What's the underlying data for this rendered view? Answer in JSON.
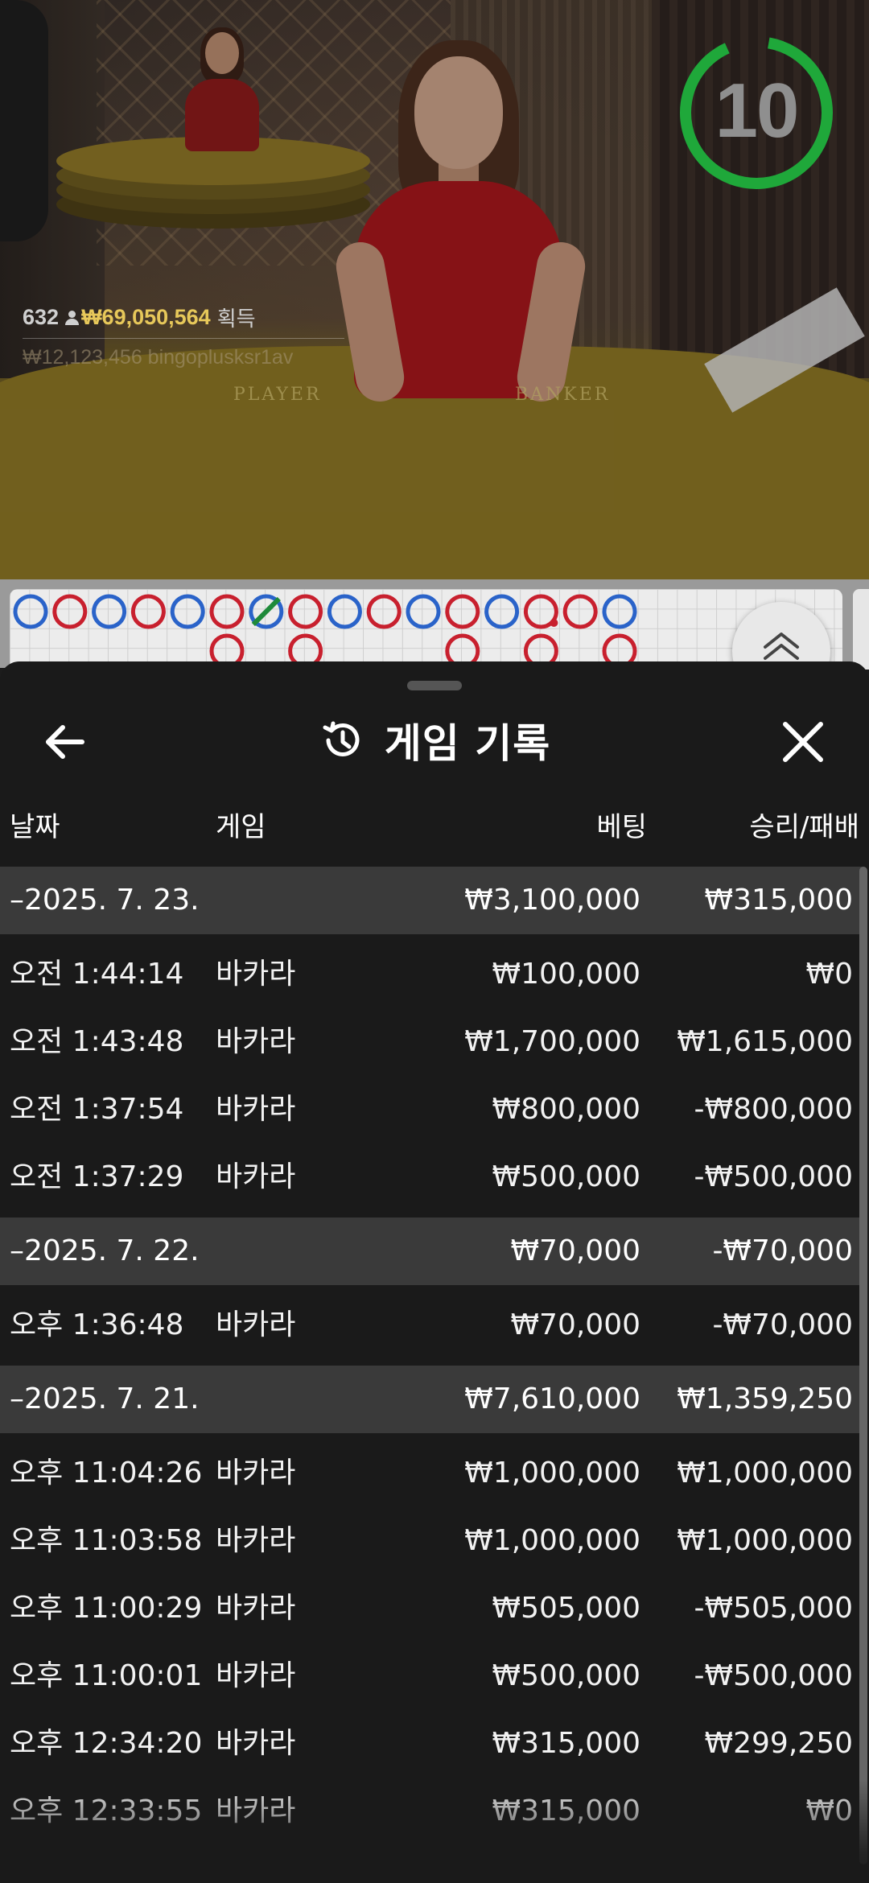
{
  "video": {
    "timer": "10",
    "player_count": "632",
    "jackpot_amount": "₩69,050,564",
    "jackpot_suffix": "획득",
    "recent_winner": "₩12,123,456  bingoplusksr1av",
    "table_labels": [
      "PLAYER",
      "BANKER"
    ],
    "timer_color": "#1fa83a"
  },
  "road": {
    "colors": {
      "banker": "#c8202e",
      "player": "#2a63c9",
      "tie": "#1f8a3a"
    },
    "top_row": [
      "P",
      "B",
      "P",
      "B",
      "P",
      "B",
      "P-tie",
      "B",
      "P",
      "B",
      "P",
      "B",
      "P",
      "B-pair",
      "B",
      "P"
    ],
    "bottom_row": [
      null,
      null,
      null,
      null,
      null,
      "B",
      null,
      "B",
      null,
      null,
      null,
      "B",
      null,
      "B",
      null,
      "B"
    ]
  },
  "sheet": {
    "title": "게임 기록",
    "icons": {
      "back": "arrow-left-icon",
      "history": "history-icon",
      "close": "close-icon"
    },
    "columns": {
      "date": "날짜",
      "game": "게임",
      "bet": "베팅",
      "winloss": "승리/패배"
    },
    "groups": [
      {
        "date": "–2025. 7. 23.",
        "bet": "₩3,100,000",
        "winloss": "₩315,000",
        "rows": [
          {
            "time": "오전 1:44:14",
            "game": "바카라",
            "bet": "₩100,000",
            "winloss": "₩0"
          },
          {
            "time": "오전 1:43:48",
            "game": "바카라",
            "bet": "₩1,700,000",
            "winloss": "₩1,615,000"
          },
          {
            "time": "오전 1:37:54",
            "game": "바카라",
            "bet": "₩800,000",
            "winloss": "-₩800,000"
          },
          {
            "time": "오전 1:37:29",
            "game": "바카라",
            "bet": "₩500,000",
            "winloss": "-₩500,000"
          }
        ]
      },
      {
        "date": "–2025. 7. 22.",
        "bet": "₩70,000",
        "winloss": "-₩70,000",
        "rows": [
          {
            "time": "오후 1:36:48",
            "game": "바카라",
            "bet": "₩70,000",
            "winloss": "-₩70,000"
          }
        ]
      },
      {
        "date": "–2025. 7. 21.",
        "bet": "₩7,610,000",
        "winloss": "₩1,359,250",
        "rows": [
          {
            "time": "오후 11:04:26",
            "game": "바카라",
            "bet": "₩1,000,000",
            "winloss": "₩1,000,000"
          },
          {
            "time": "오후 11:03:58",
            "game": "바카라",
            "bet": "₩1,000,000",
            "winloss": "₩1,000,000"
          },
          {
            "time": "오후 11:00:29",
            "game": "바카라",
            "bet": "₩505,000",
            "winloss": "-₩505,000"
          },
          {
            "time": "오후 11:00:01",
            "game": "바카라",
            "bet": "₩500,000",
            "winloss": "-₩500,000"
          },
          {
            "time": "오후 12:34:20",
            "game": "바카라",
            "bet": "₩315,000",
            "winloss": "₩299,250"
          },
          {
            "time": "오후 12:33:55",
            "game": "바카라",
            "bet": "₩315,000",
            "winloss": "₩0"
          }
        ]
      }
    ]
  }
}
